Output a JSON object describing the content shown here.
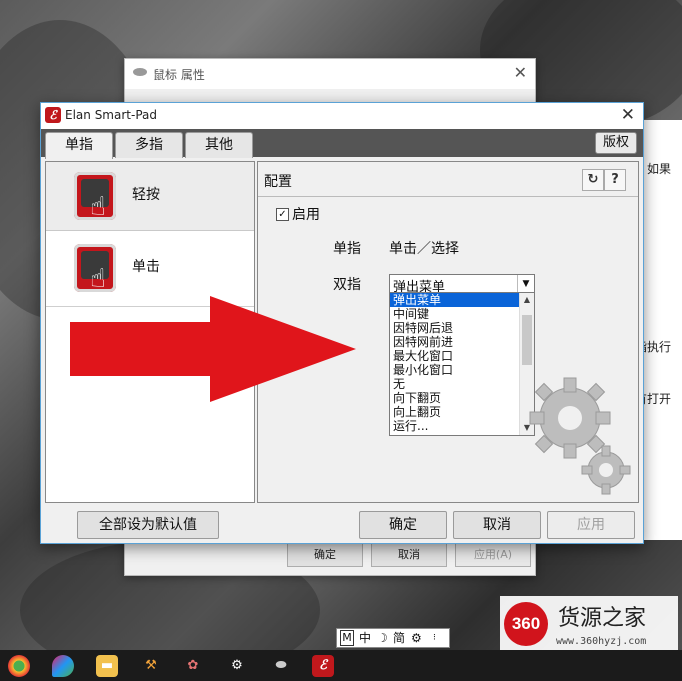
{
  "bg_window": {
    "title": "鼠标 属性",
    "buttons": {
      "ok": "确定",
      "cancel": "取消",
      "apply": "应用(A)"
    }
  },
  "right_panel": {
    "texts": [
      "。如果",
      "指执行",
      "有打开"
    ]
  },
  "main_window": {
    "title": "Elan Smart-Pad",
    "tabs": [
      "单指",
      "多指",
      "其他"
    ],
    "version_button": "版权",
    "gestures": [
      {
        "label": "轻按",
        "selected": true
      },
      {
        "label": "单击",
        "selected": false
      }
    ],
    "config": {
      "title": "配置",
      "enable_label": "启用",
      "enabled": true,
      "single_finger_label": "单指",
      "single_finger_value": "单击／选择",
      "two_finger_label": "双指",
      "two_finger_value": "弹出菜单",
      "dropdown_options": [
        "弹出菜单",
        "中间键",
        "因特网后退",
        "因特网前进",
        "最大化窗口",
        "最小化窗口",
        "无",
        "向下翻页",
        "向上翻页",
        "运行..."
      ],
      "highlighted_option": 0
    },
    "buttons": {
      "defaults": "全部设为默认值",
      "ok": "确定",
      "cancel": "取消",
      "apply": "应用"
    }
  },
  "ime": {
    "mode": "M",
    "lang": "中",
    "moon": "☽",
    "simp": "简",
    "gear": "⚙"
  },
  "watermark": {
    "logo": "360",
    "name": "货源之家",
    "url": "www.360hyzj.com"
  },
  "taskbar": {
    "icons": [
      "chrome-like-icon",
      "paint-icon",
      "file-explorer-icon",
      "broom-icon",
      "palette-icon",
      "settings-icon",
      "mouse-icon",
      "elan-icon"
    ]
  },
  "colors": {
    "accent": "#0a64d8",
    "brand_red": "#c4161c",
    "arrow_red": "#e0151b"
  }
}
